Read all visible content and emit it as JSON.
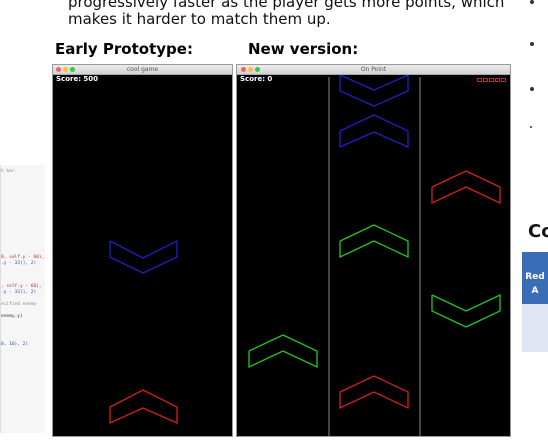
{
  "article": {
    "intro_line1": "progressively faster as the player gets more points, which",
    "intro_line2": "makes it harder to match them up.",
    "label_early": "Early Prototype:",
    "label_new": "New version:"
  },
  "code_snippet": {
    "lines": [
      {
        "text": "h bar.",
        "color": "gray"
      },
      {
        "text": "0, self.y - 60),",
        "color": "red"
      },
      {
        "text": ".y - 33)], 2)",
        "color": "blue"
      },
      {
        "text": ", self.y - 60),",
        "color": "red"
      },
      {
        "text": ".y - 33)], 2)",
        "color": "blue"
      },
      {
        "text": "ecified enemy",
        "color": "gray"
      },
      {
        "text": "enemy.y)",
        "color": "dark"
      },
      {
        "text": "0, 10), 2)",
        "color": "blue"
      }
    ]
  },
  "prototype_window": {
    "title": "cool game",
    "score_text": "Score: 500"
  },
  "new_window": {
    "title": "On Point",
    "score_text": "Score: 0",
    "lives_count": 5
  },
  "right_panel": {
    "heading": "Co",
    "table_header_line1": "Red",
    "table_header_line2": "A"
  },
  "colors": {
    "blue": "#2020c8",
    "red": "#d42020",
    "green": "#1ec81e",
    "lane_divider": "#8a8a8a"
  }
}
